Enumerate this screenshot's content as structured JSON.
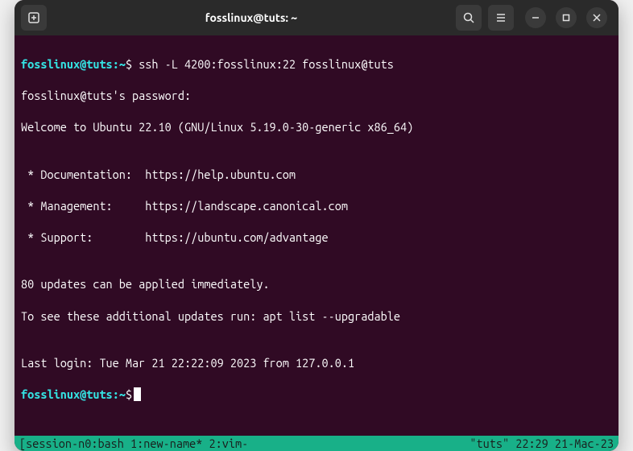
{
  "titlebar": {
    "title": "fosslinux@tuts: ~"
  },
  "terminal": {
    "prompt1": {
      "user": "fosslinux@tuts",
      "sep": ":",
      "path": "~",
      "symbol": "$",
      "command": "ssh -L 4200:fosslinux:22 fosslinux@tuts"
    },
    "lines": {
      "l1": "fosslinux@tuts's password:",
      "l2": "Welcome to Ubuntu 22.10 (GNU/Linux 5.19.0-30-generic x86_64)",
      "l3": "",
      "l4": " * Documentation:  https://help.ubuntu.com",
      "l5": " * Management:     https://landscape.canonical.com",
      "l6": " * Support:        https://ubuntu.com/advantage",
      "l7": "",
      "l8": "80 updates can be applied immediately.",
      "l9": "To see these additional updates run: apt list --upgradable",
      "l10": "",
      "l11": "Last login: Tue Mar 21 22:22:09 2023 from 127.0.0.1"
    },
    "prompt2": {
      "user": "fosslinux@tuts",
      "sep": ":",
      "path": "~",
      "symbol": "$"
    }
  },
  "statusbar": {
    "left": "[session-n0:bash  1:new-name* 2:vim-",
    "right": "\"tuts\" 22:29 21-Mac-23"
  }
}
